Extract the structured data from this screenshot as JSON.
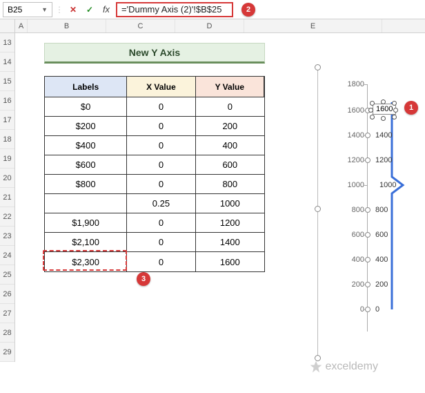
{
  "name_box": "B25",
  "formula": "='Dummy Axis (2)'!$B$25",
  "columns": [
    "A",
    "B",
    "C",
    "D",
    "E"
  ],
  "rows": [
    "13",
    "14",
    "15",
    "16",
    "17",
    "18",
    "19",
    "20",
    "21",
    "22",
    "23",
    "24",
    "25",
    "26",
    "27",
    "28",
    "29"
  ],
  "title": "New Y Axis",
  "table": {
    "headers": {
      "labels": "Labels",
      "x": "X Value",
      "y": "Y Value"
    },
    "rows": [
      {
        "label": "$0",
        "x": "0",
        "y": "0"
      },
      {
        "label": "$200",
        "x": "0",
        "y": "200"
      },
      {
        "label": "$400",
        "x": "0",
        "y": "400"
      },
      {
        "label": "$600",
        "x": "0",
        "y": "600"
      },
      {
        "label": "$800",
        "x": "0",
        "y": "800"
      },
      {
        "label": "",
        "x": "0.25",
        "y": "1000"
      },
      {
        "label": "$1,900",
        "x": "0",
        "y": "1200"
      },
      {
        "label": "$2,100",
        "x": "0",
        "y": "1400"
      },
      {
        "label": "$2,300",
        "x": "0",
        "y": "1600"
      }
    ]
  },
  "chart": {
    "axis_ticks": [
      "1800",
      "1600",
      "1400",
      "1200",
      "1000",
      "800",
      "600",
      "400",
      "200",
      "0"
    ],
    "data_labels": [
      "1600",
      "1400",
      "1200",
      "1000",
      "800",
      "600",
      "400",
      "200",
      "0"
    ],
    "selected_label": "1600"
  },
  "badges": {
    "b1": "1",
    "b2": "2",
    "b3": "3"
  },
  "watermark": "exceldemy"
}
